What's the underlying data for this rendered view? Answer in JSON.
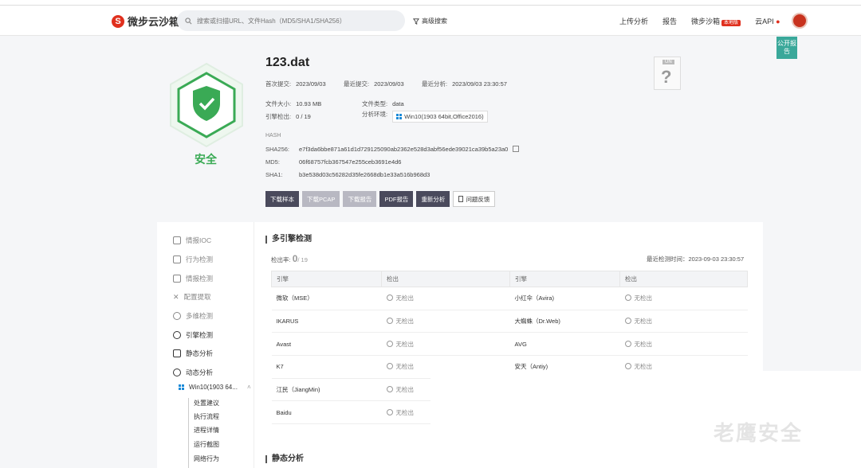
{
  "nav": {
    "logo": "微步云沙箱",
    "search_placeholder": "搜索或扫描URL、文件Hash（MD5/SHA1/SHA256）",
    "advanced": "高级搜索",
    "links": [
      "上传分析",
      "报告",
      "微步沙箱",
      "云API"
    ],
    "local_badge": "本地版"
  },
  "public_report": "公开报告",
  "verdict": "安全",
  "file": {
    "name": "123.dat",
    "first_submit_label": "首次提交:",
    "first_submit": "2023/09/03",
    "last_submit_label": "最近提交:",
    "last_submit": "2023/09/03",
    "last_analysis_label": "最近分析:",
    "last_analysis": "2023/09/03 23:30:57",
    "size_label": "文件大小:",
    "size": "10.93 MB",
    "type_label": "文件类型:",
    "type": "data",
    "engine_label": "引擎检出:",
    "engine": "0 / 19",
    "env_label": "分析环境:",
    "env": "Win10(1903 64bit,Office2016)"
  },
  "hash": {
    "title": "HASH",
    "sha256_label": "SHA256:",
    "sha256": "e7f3da6bbe871a61d1d729125090ab2362e528d3abf56ede39021ca39b5a23a0",
    "md5_label": "MD5:",
    "md5": "06f68757fcb367547e255ceb3691e4d6",
    "sha1_label": "SHA1:",
    "sha1": "b3e538d03c56282d35fe2668db1e33a516b968d3"
  },
  "unknown_badge": "UN",
  "buttons": [
    "下载样本",
    "下载PCAP",
    "下载报告",
    "PDF报告",
    "重新分析",
    "问题反馈"
  ],
  "sidebar": {
    "items": [
      "情报IOC",
      "行为检测",
      "情报检测",
      "配置提取",
      "多维检测",
      "引擎检测",
      "静态分析",
      "动态分析"
    ],
    "env": "Win10(1903 64...",
    "sub_items": [
      "处置建议",
      "执行流程",
      "进程详情",
      "运行截图",
      "网络行为"
    ]
  },
  "multi_engine": {
    "title": "多引擎检测",
    "rate_label": "检出率:",
    "rate_num": "0",
    "rate_total": "/ 19",
    "latest": "最近检测时间：2023-09-03 23:30:57",
    "headers": [
      "引擎",
      "检出",
      "引擎",
      "检出"
    ],
    "rows": [
      [
        "微软（MSE）",
        "无检出",
        "小红伞（Avira)",
        "无检出"
      ],
      [
        "IKARUS",
        "无检出",
        "大蜘蛛（Dr.Web)",
        "无检出"
      ],
      [
        "Avast",
        "无检出",
        "AVG",
        "无检出"
      ],
      [
        "K7",
        "无检出",
        "安天（Antiy)",
        "无检出"
      ],
      [
        "江民（JiangMin)",
        "无检出",
        "",
        ""
      ],
      [
        "Baidu",
        "无检出",
        "",
        ""
      ]
    ]
  },
  "static_title": "静态分析",
  "watermark": "老鹰安全"
}
